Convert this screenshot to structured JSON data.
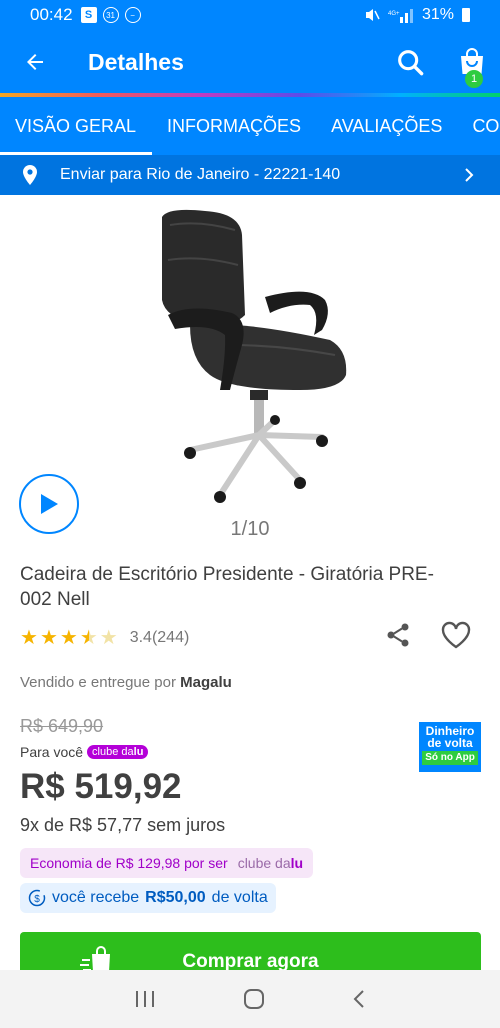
{
  "status": {
    "time": "00:42",
    "battery": "31%"
  },
  "appbar": {
    "title": "Detalhes",
    "cart_count": "1"
  },
  "tabs": [
    {
      "label": "VISÃO GERAL",
      "active": true
    },
    {
      "label": "INFORMAÇÕES",
      "active": false
    },
    {
      "label": "AVALIAÇÕES",
      "active": false
    },
    {
      "label": "COM",
      "active": false
    }
  ],
  "delivery": {
    "text": "Enviar para Rio de Janeiro - 22221-140"
  },
  "gallery": {
    "counter": "1/10"
  },
  "product": {
    "name": "Cadeira de Escritório Presidente  - Giratória PRE-002 Nell",
    "rating_value": "3.4",
    "rating_count": "(244)",
    "rating_score": 3.4,
    "seller_prefix": "Vendido e entregue por",
    "seller_name": "Magalu",
    "old_price": "R$ 649,90",
    "for_you_label": "Para você",
    "club_brand_a": "clube da",
    "club_brand_b": "lu",
    "price": "R$ 519,92",
    "installments": "9x de R$ 57,77 sem juros",
    "economy_text": "Economia de R$ 129,98 por ser",
    "receive_prefix": "você recebe",
    "receive_amount": "R$50,00",
    "receive_suffix": "de volta"
  },
  "cashback_badge": {
    "line1": "Dinheiro",
    "line2": "de volta",
    "line3": "Só no App"
  },
  "buy_button": {
    "label": "Comprar agora"
  },
  "colors": {
    "primary": "#0086ff",
    "buy": "#2dbe1c",
    "club": "#b400d8"
  }
}
